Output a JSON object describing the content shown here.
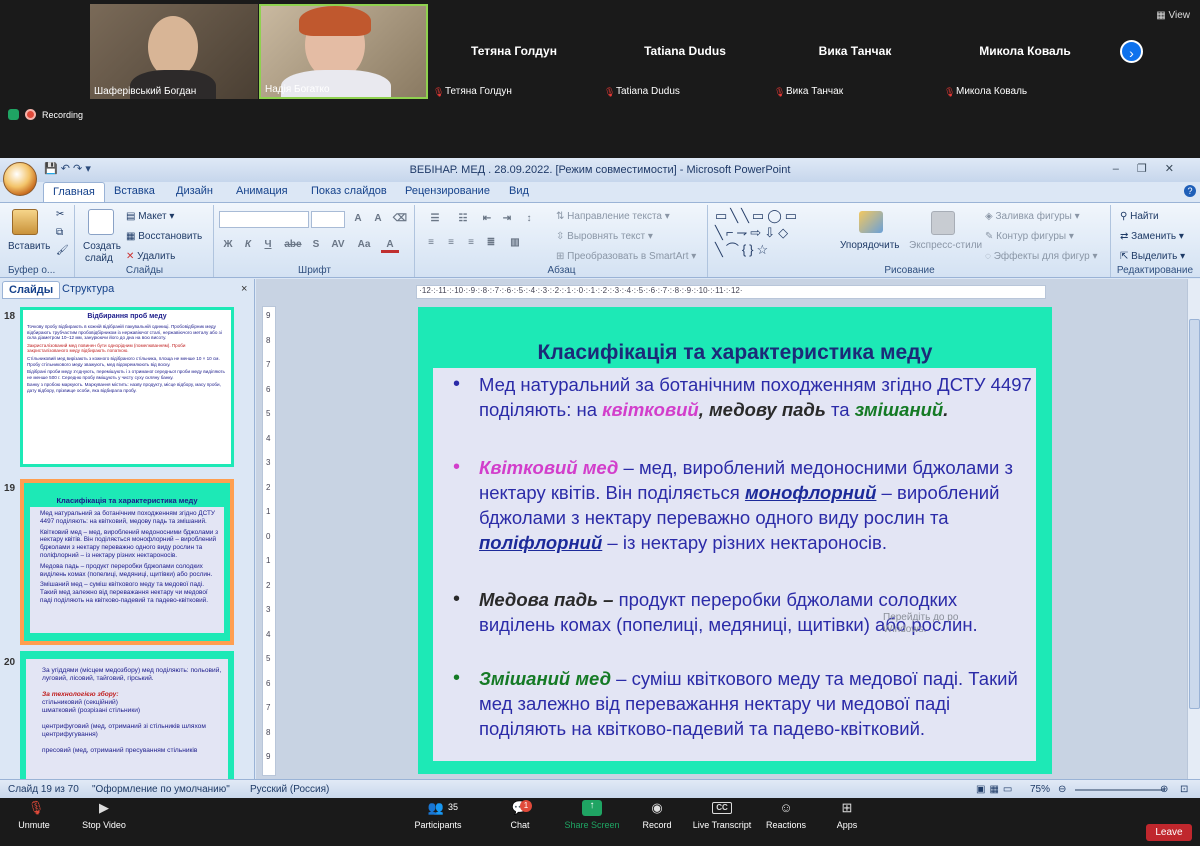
{
  "zoom_top": {
    "view_label": "View",
    "participants": [
      {
        "name": "Шаферівський Богдан",
        "has_video": true,
        "muted": false
      },
      {
        "name": "Надія Богатко",
        "has_video": true,
        "muted": false
      },
      {
        "name": "Тетяна Голдун",
        "has_video": false,
        "muted": true
      },
      {
        "name": "Tatiana Dudus",
        "has_video": false,
        "muted": true
      },
      {
        "name": "Вика Танчак",
        "has_video": false,
        "muted": true
      },
      {
        "name": "Микола Коваль",
        "has_video": false,
        "muted": true
      }
    ],
    "recording_label": "Recording"
  },
  "window": {
    "title": "ВЕБІНАР. МЕД . 28.09.2022. [Режим совместимости] - Microsoft PowerPoint"
  },
  "ribbon": {
    "tabs": [
      "Главная",
      "Вставка",
      "Дизайн",
      "Анимация",
      "Показ слайдов",
      "Рецензирование",
      "Вид"
    ],
    "active_tab": "Главная",
    "groups": {
      "clipboard": {
        "label": "Буфер о...",
        "paste": "Вставить"
      },
      "slides": {
        "label": "Слайды",
        "new_slide_1": "Создать",
        "new_slide_2": "слайд",
        "layout": "Макет",
        "reset": "Восстановить",
        "delete": "Удалить"
      },
      "font": {
        "label": "Шрифт",
        "buttons": [
          "Ж",
          "К",
          "Ч",
          "abe",
          "S",
          "AV",
          "Aa",
          "A"
        ]
      },
      "paragraph": {
        "label": "Абзац",
        "text_direction": "Направление текста",
        "align_text": "Выровнять текст",
        "smartart": "Преобразовать в SmartArt"
      },
      "drawing": {
        "label": "Рисование",
        "arrange": "Упорядочить",
        "quick_styles": "Экспресс-стили",
        "shape_fill": "Заливка фигуры",
        "shape_outline": "Контур фигуры",
        "shape_effects": "Эффекты для фигур"
      },
      "editing": {
        "label": "Редактирование",
        "find": "Найти",
        "replace": "Заменить",
        "select": "Выделить"
      }
    }
  },
  "left_pane": {
    "tab_slides": "Слайды",
    "tab_outline": "Структура",
    "close": "×",
    "thumbs": [
      {
        "num": "18",
        "title": "Відбирання проб меду",
        "paragraphs": [
          "Точкову пробу відбирають в кожній відібраній пакувальній одиниці. Пробовідбірник меду відбирають трубчастим пробовідбірником із нержавіючої сталі, нержавіючого металу або зі скла діаметром 10–12 мм, занурюючи його до дна на всю висоту.",
          "Закристалізований мед повинен бути однорідним (помелюванням). Проби закристалізованого меду відбирають лопаткою.",
          "Стільниковий мед вирізають з кожного відібраного стільника, площа не менше 10 × 10 см. Пробу стільникового меду зважують, мед відокремлюють від воску.",
          "Відібрані проби меду з'єднують, перемішують і з отриманої середньої проби меду виділяють не менше 500 г. Середню пробу вміщують у чисту суху скляну банку.",
          "Банку з пробою маркують. Маркування містить: назву продукту, місце відбору, масу проби, дату відбору, прізвище особи, яка відбирала пробу."
        ]
      },
      {
        "num": "19",
        "title": "Класифікація та характеристика меду",
        "lines": [
          "Мед натуральний за ботанічним походженням згідно ДСТУ 4497 поділяють: на квітковий, медову падь та змішаний.",
          "Квітковий мед – мед, вироблений медоносними бджолами з нектару квітів. Він поділяється монофлорний – вироблений бджолами з нектару переважно одного виду рослин та поліфлорний – із нектару різних нектароносів.",
          "Медова падь – продукт переробки бджолами солодких виділень комах (попелиці, медяниці, щитівки) або рослин.",
          "Змішаний мед – суміш квіткового меду та медової паді. Такий мед залежно від переважання нектару чи медової паді поділяють на квітково-падевий та падево-квітковий."
        ]
      },
      {
        "num": "20",
        "lines": [
          "За угіддями (місцем медозбору) мед поділяють: польовий, луговий, лісовий, тайговий, гірський.",
          "За технологією збору:",
          "стільниковий (секційний)",
          "шматковий (розрізані стільники)",
          "центрифуговий (мед, отриманий зі стільників шляхом центрифугування)",
          "пресовий (мед, отриманий пресуванням стільників"
        ]
      }
    ]
  },
  "slide": {
    "title": "Класифікація та характеристика меду",
    "b1": {
      "t1": "Мед натуральний за ботанічним походженням згідно ДСТУ 4497 поділяють: на ",
      "k1": "квітковий",
      "sep": ",",
      "k2": " медову падь",
      "t2": " та ",
      "k3": "змішаний",
      "end": "."
    },
    "b2": {
      "k": "Квітковий мед",
      "t1": " – мед, вироблений медоносними бджолами з нектару квітів. Він поділяється ",
      "u1": "монофлорний",
      "t2": " – вироблений бджолами з нектару переважно одного виду рослин та ",
      "u2": "поліфлорний",
      "t3": " – із нектару різних нектароносів."
    },
    "b3": {
      "k": "Медова падь –",
      "t": " продукт переробки бджолами солодких виділень комах (попелиці, медяниці, щитівки) або рослин."
    },
    "b4": {
      "k": "Змішаний мед",
      "t": " – суміш квіткового меду та медової паді. Такий мед залежно від переважання нектару чи медової паді поділяють на квітково-падевий та падево-квітковий."
    }
  },
  "status": {
    "slide_of": "Слайд 19 из 70",
    "theme": "\"Оформление по умолчанию\"",
    "language": "Русский (Россия)",
    "zoom": "75%",
    "watermark1": "Перейдіть до ро",
    "watermark2": "Windows."
  },
  "zoom_bottom": {
    "participants_count": "35",
    "chat_badge": "1",
    "items": [
      "Unmute",
      "Stop Video",
      "Participants",
      "Chat",
      "Share Screen",
      "Record",
      "Live Transcript",
      "Reactions",
      "Apps"
    ],
    "leave": "Leave"
  },
  "colors": {
    "accent": "#1de9b6",
    "zoom_blue": "#0e72ed",
    "leave_red": "#c0272d",
    "share_green": "#1fa463"
  }
}
